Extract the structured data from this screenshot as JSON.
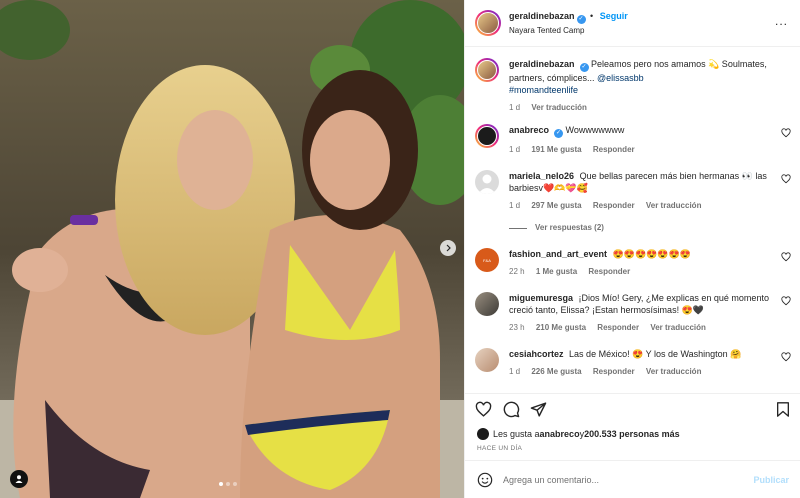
{
  "post": {
    "username": "geraldinebazan",
    "follow_label": "Seguir",
    "separator": "•",
    "location": "Nayara Tented Camp",
    "more_label": "..."
  },
  "caption": {
    "username": "geraldinebazan",
    "text": "Peleamos pero nos amamos 💫 Soulmates, partners, cómplices... ",
    "mention": "@elissasbb",
    "hashtag": "#momandteenlife",
    "time": "1 d",
    "translate": "Ver traducción"
  },
  "comments": [
    {
      "username": "anabreco",
      "verified": true,
      "text": "Wowwwwwww",
      "time": "1 d",
      "likes": "191 Me gusta",
      "reply": "Responder",
      "translate": ""
    },
    {
      "username": "mariela_nelo26",
      "verified": false,
      "text": "Que bellas parecen más bien hermanas 👀 las barbiesv❤️🫶💝🥰",
      "time": "1 d",
      "likes": "297 Me gusta",
      "reply": "Responder",
      "translate": "Ver traducción",
      "replies": "Ver respuestas (2)"
    },
    {
      "username": "fashion_and_art_event",
      "verified": false,
      "text": "😍😍😍😍😍😍😍",
      "time": "22 h",
      "likes": "1 Me gusta",
      "reply": "Responder",
      "translate": ""
    },
    {
      "username": "miguemuresga",
      "verified": false,
      "text": "¡Dios Mío! Gery, ¿Me explicas en qué momento creció tanto, Elissa? ¡Estan hermosísimas! 😍🖤",
      "time": "23 h",
      "likes": "210 Me gusta",
      "reply": "Responder",
      "translate": "Ver traducción"
    },
    {
      "username": "cesiahcortez",
      "verified": false,
      "text": "Las de México! 😍 Y los de Washington 🤗",
      "time": "1 d",
      "likes": "226 Me gusta",
      "reply": "Responder",
      "translate": "Ver traducción"
    }
  ],
  "likes": {
    "prefix": "Les gusta a ",
    "user": "anabreco",
    "middle": " y ",
    "count": "200.533 personas más"
  },
  "timestamp": "HACE UN DÍA",
  "add_comment": {
    "placeholder": "Agrega un comentario...",
    "publish": "Publicar"
  },
  "icons": {
    "like": "heart-icon",
    "comment": "comment-icon",
    "share": "share-icon",
    "save": "bookmark-icon",
    "emoji": "emoji-icon"
  },
  "colors": {
    "link": "#0095f6",
    "verified": "#3797f0",
    "hashtag": "#00376b"
  }
}
